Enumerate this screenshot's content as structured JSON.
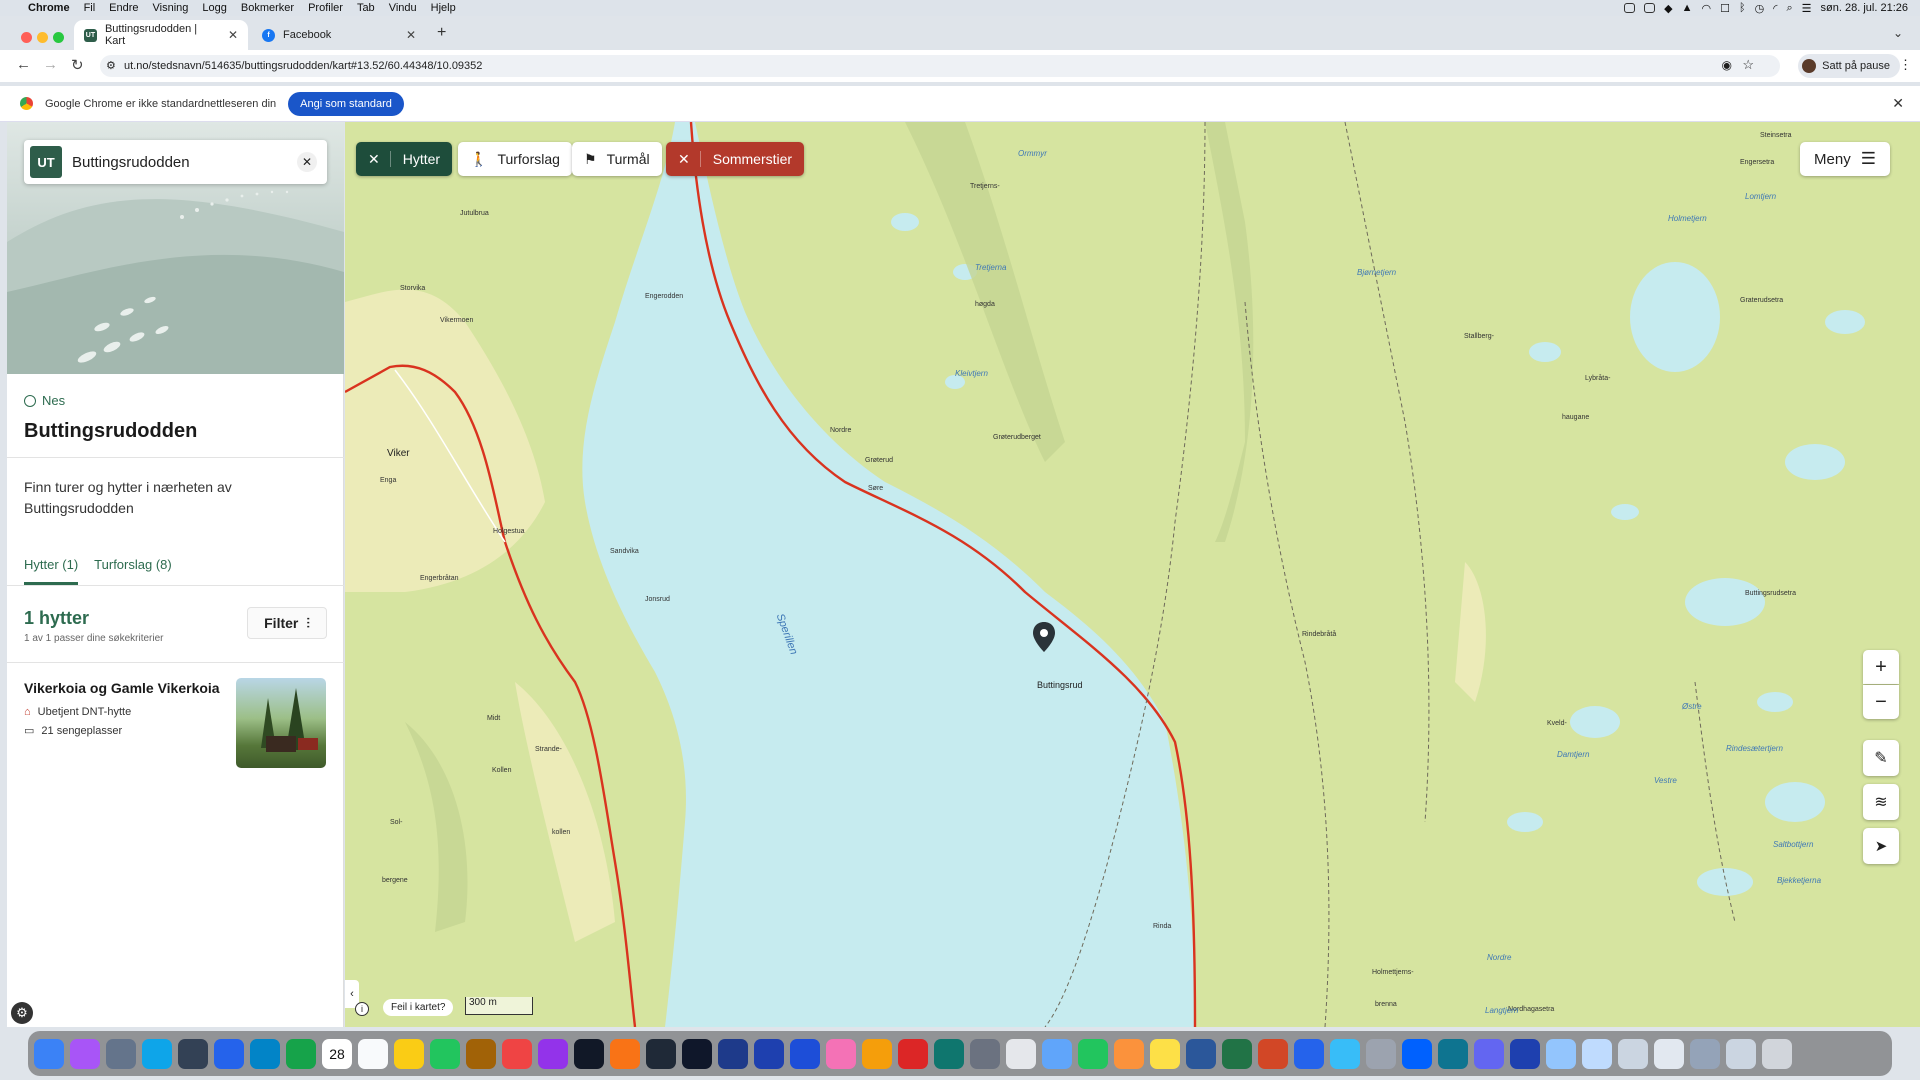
{
  "menubar": {
    "apple": "",
    "app": "Chrome",
    "items": [
      "Fil",
      "Endre",
      "Visning",
      "Logg",
      "Bokmerker",
      "Profiler",
      "Tab",
      "Vindu",
      "Hjelp"
    ],
    "clock": "søn. 28. jul.  21:26"
  },
  "tabs": [
    {
      "label": "Buttingsrudodden | Kart",
      "favicon": "UT",
      "color": "#2e5d4a"
    },
    {
      "label": "Facebook",
      "favicon": "f",
      "color": "#1877f2"
    }
  ],
  "address": {
    "url": "ut.no/stedsnavn/514635/buttingsrudodden/kart#13.52/60.44348/10.09352",
    "profile_label": "Satt på pause"
  },
  "infobar": {
    "message": "Google Chrome er ikke standardnettleseren din",
    "button": "Angi som standard"
  },
  "sidebar": {
    "search_logo": "UT",
    "search_value": "Buttingsrudodden",
    "municipality": "Nes",
    "place_title": "Buttingsrudodden",
    "intro": "Finn turer og hytter i nærheten av Buttingsrudodden",
    "tabs": [
      "Hytter (1)",
      "Turforslag (8)"
    ],
    "result_count": "1 hytter",
    "result_sub": "1 av 1 passer dine søkekriterier",
    "filter_label": "Filter",
    "cabin": {
      "name": "Vikerkoia og Gamle Vikerkoia",
      "type": "Ubetjent DNT-hytte",
      "beds": "21 sengeplasser"
    }
  },
  "map": {
    "filters": [
      {
        "label": "Hytter",
        "active": true,
        "color": "#1e4d3b"
      },
      {
        "label": "Turforslag",
        "active": false
      },
      {
        "label": "Turmål",
        "active": false
      },
      {
        "label": "Sommerstier",
        "active": true,
        "color": "#b3392b"
      }
    ],
    "menu_label": "Meny",
    "report_label": "Feil i kartet?",
    "scale": "300 m",
    "lake_name": "Sperillen",
    "marker_label": "Buttingsrud",
    "labels": [
      {
        "t": "Jutulbrua"
      },
      {
        "t": "Storvika"
      },
      {
        "t": "Vikermoen"
      },
      {
        "t": "Engerodden"
      },
      {
        "t": "Viker"
      },
      {
        "t": "Enga"
      },
      {
        "t": "Holgestua"
      },
      {
        "t": "Sandvika"
      },
      {
        "t": "Engerbråtan"
      },
      {
        "t": "Jonsrud"
      },
      {
        "t": "Midt"
      },
      {
        "t": "Strande-"
      },
      {
        "t": "Kollen"
      },
      {
        "t": "kollen"
      },
      {
        "t": "Sol-"
      },
      {
        "t": "bergene"
      },
      {
        "t": "Nordre"
      },
      {
        "t": "Grøterud"
      },
      {
        "t": "Søre"
      },
      {
        "t": "høgda"
      },
      {
        "t": "Tretjerns-"
      },
      {
        "t": "Grøterudberget"
      },
      {
        "t": "Rinda"
      },
      {
        "t": "Rindebråtå"
      },
      {
        "t": "Stallberg-"
      },
      {
        "t": "Lybråta-"
      },
      {
        "t": "haugane"
      },
      {
        "t": "Graterudsetra"
      },
      {
        "t": "Buttingsrudsetra"
      },
      {
        "t": "Engersetra"
      },
      {
        "t": "Holmettjerns-"
      },
      {
        "t": "brenna"
      },
      {
        "t": "Nordhagasetra"
      },
      {
        "t": "Steinsetra"
      },
      {
        "t": "Kveld-"
      }
    ],
    "water_labels": [
      {
        "t": "Tretjerna"
      },
      {
        "t": "Kleivtjern"
      },
      {
        "t": "Bjørnetjern"
      },
      {
        "t": "Holmetjern"
      },
      {
        "t": "Lomtjern"
      },
      {
        "t": "Damtjern"
      },
      {
        "t": "Vestre"
      },
      {
        "t": "Østre"
      },
      {
        "t": "Rindesætertjern"
      },
      {
        "t": "Saltbottjern"
      },
      {
        "t": "Bjekketjerna"
      },
      {
        "t": "Nordre"
      },
      {
        "t": "Langtjern"
      },
      {
        "t": "Ormmyr"
      }
    ]
  },
  "dock": {
    "calendar_day": "28",
    "apps": [
      "finder",
      "siri",
      "launchpad",
      "app-store",
      "mission-control",
      "mail",
      "safari",
      "chrome",
      "calendar",
      "reminders",
      "notes",
      "maps",
      "contacts",
      "music",
      "podcasts",
      "tv",
      "books",
      "terminal",
      "lightroom",
      "photoshop",
      "photoshop-2",
      "photoshop-3",
      "photos",
      "garageband",
      "keynote",
      "time-machine",
      "settings",
      "pen",
      "bridge",
      "numbers",
      "pages",
      "stickies",
      "word",
      "excel",
      "powerpoint",
      "vpn",
      "preview",
      "help",
      "dropbox",
      "teamviewer",
      "drive",
      "wd",
      "folder-1",
      "folder-2",
      "folder-3",
      "folder-4",
      "folder-5",
      "folder-6",
      "trash"
    ]
  }
}
